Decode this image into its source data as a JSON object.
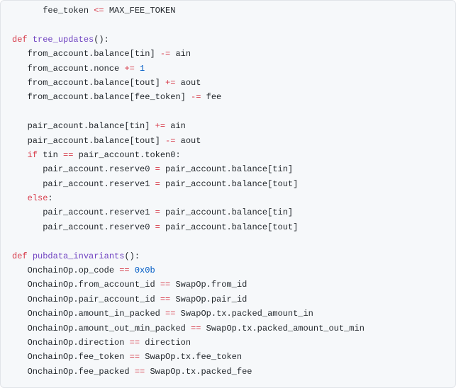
{
  "code": {
    "lines": [
      {
        "indent": 2,
        "tokens": [
          {
            "cls": "txt",
            "t": "fee_token "
          },
          {
            "cls": "op",
            "t": "<="
          },
          {
            "cls": "txt",
            "t": " MAX_FEE_TOKEN"
          }
        ]
      },
      {
        "indent": 0,
        "tokens": [
          {
            "cls": "txt",
            "t": ""
          }
        ]
      },
      {
        "indent": 0,
        "tokens": [
          {
            "cls": "kw",
            "t": "def"
          },
          {
            "cls": "txt",
            "t": " "
          },
          {
            "cls": "fn",
            "t": "tree_updates"
          },
          {
            "cls": "txt",
            "t": "():"
          }
        ]
      },
      {
        "indent": 1,
        "tokens": [
          {
            "cls": "txt",
            "t": "from_account.balance[tin] "
          },
          {
            "cls": "op",
            "t": "-="
          },
          {
            "cls": "txt",
            "t": " ain"
          }
        ]
      },
      {
        "indent": 1,
        "tokens": [
          {
            "cls": "txt",
            "t": "from_account.nonce "
          },
          {
            "cls": "op",
            "t": "+="
          },
          {
            "cls": "txt",
            "t": " "
          },
          {
            "cls": "num",
            "t": "1"
          }
        ]
      },
      {
        "indent": 1,
        "tokens": [
          {
            "cls": "txt",
            "t": "from_account.balance[tout] "
          },
          {
            "cls": "op",
            "t": "+="
          },
          {
            "cls": "txt",
            "t": " aout"
          }
        ]
      },
      {
        "indent": 1,
        "tokens": [
          {
            "cls": "txt",
            "t": "from_account.balance[fee_token] "
          },
          {
            "cls": "op",
            "t": "-="
          },
          {
            "cls": "txt",
            "t": " fee"
          }
        ]
      },
      {
        "indent": 0,
        "tokens": [
          {
            "cls": "txt",
            "t": ""
          }
        ]
      },
      {
        "indent": 1,
        "tokens": [
          {
            "cls": "txt",
            "t": "pair_acount.balance[tin] "
          },
          {
            "cls": "op",
            "t": "+="
          },
          {
            "cls": "txt",
            "t": " ain"
          }
        ]
      },
      {
        "indent": 1,
        "tokens": [
          {
            "cls": "txt",
            "t": "pair_account.balance[tout] "
          },
          {
            "cls": "op",
            "t": "-="
          },
          {
            "cls": "txt",
            "t": " aout"
          }
        ]
      },
      {
        "indent": 1,
        "tokens": [
          {
            "cls": "kw",
            "t": "if"
          },
          {
            "cls": "txt",
            "t": " tin "
          },
          {
            "cls": "op",
            "t": "=="
          },
          {
            "cls": "txt",
            "t": " pair_account.token0:"
          }
        ]
      },
      {
        "indent": 2,
        "tokens": [
          {
            "cls": "txt",
            "t": "pair_account.reserve0 "
          },
          {
            "cls": "op",
            "t": "="
          },
          {
            "cls": "txt",
            "t": " pair_account.balance[tin]"
          }
        ]
      },
      {
        "indent": 2,
        "tokens": [
          {
            "cls": "txt",
            "t": "pair_account.reserve1 "
          },
          {
            "cls": "op",
            "t": "="
          },
          {
            "cls": "txt",
            "t": " pair_account.balance[tout]"
          }
        ]
      },
      {
        "indent": 1,
        "tokens": [
          {
            "cls": "kw",
            "t": "else"
          },
          {
            "cls": "txt",
            "t": ":"
          }
        ]
      },
      {
        "indent": 2,
        "tokens": [
          {
            "cls": "txt",
            "t": "pair_account.reserve1 "
          },
          {
            "cls": "op",
            "t": "="
          },
          {
            "cls": "txt",
            "t": " pair_account.balance[tin]"
          }
        ]
      },
      {
        "indent": 2,
        "tokens": [
          {
            "cls": "txt",
            "t": "pair_account.reserve0 "
          },
          {
            "cls": "op",
            "t": "="
          },
          {
            "cls": "txt",
            "t": " pair_account.balance[tout]"
          }
        ]
      },
      {
        "indent": 0,
        "tokens": [
          {
            "cls": "txt",
            "t": ""
          }
        ]
      },
      {
        "indent": 0,
        "tokens": [
          {
            "cls": "kw",
            "t": "def"
          },
          {
            "cls": "txt",
            "t": " "
          },
          {
            "cls": "fn",
            "t": "pubdata_invariants"
          },
          {
            "cls": "txt",
            "t": "():"
          }
        ]
      },
      {
        "indent": 1,
        "tokens": [
          {
            "cls": "txt",
            "t": "OnchainOp.op_code "
          },
          {
            "cls": "op",
            "t": "=="
          },
          {
            "cls": "txt",
            "t": " "
          },
          {
            "cls": "num",
            "t": "0x0b"
          }
        ]
      },
      {
        "indent": 1,
        "tokens": [
          {
            "cls": "txt",
            "t": "OnchainOp.from_account_id "
          },
          {
            "cls": "op",
            "t": "=="
          },
          {
            "cls": "txt",
            "t": " SwapOp.from_id"
          }
        ]
      },
      {
        "indent": 1,
        "tokens": [
          {
            "cls": "txt",
            "t": "OnchainOp.pair_account_id "
          },
          {
            "cls": "op",
            "t": "=="
          },
          {
            "cls": "txt",
            "t": " SwapOp.pair_id"
          }
        ]
      },
      {
        "indent": 1,
        "tokens": [
          {
            "cls": "txt",
            "t": "OnchainOp.amount_in_packed "
          },
          {
            "cls": "op",
            "t": "=="
          },
          {
            "cls": "txt",
            "t": " SwapOp.tx.packed_amount_in"
          }
        ]
      },
      {
        "indent": 1,
        "tokens": [
          {
            "cls": "txt",
            "t": "OnchainOp.amount_out_min_packed "
          },
          {
            "cls": "op",
            "t": "=="
          },
          {
            "cls": "txt",
            "t": " SwapOp.tx.packed_amount_out_min"
          }
        ]
      },
      {
        "indent": 1,
        "tokens": [
          {
            "cls": "txt",
            "t": "OnchainOp.direction "
          },
          {
            "cls": "op",
            "t": "=="
          },
          {
            "cls": "txt",
            "t": " direction"
          }
        ]
      },
      {
        "indent": 1,
        "tokens": [
          {
            "cls": "txt",
            "t": "OnchainOp.fee_token "
          },
          {
            "cls": "op",
            "t": "=="
          },
          {
            "cls": "txt",
            "t": " SwapOp.tx.fee_token"
          }
        ]
      },
      {
        "indent": 1,
        "tokens": [
          {
            "cls": "txt",
            "t": "OnchainOp.fee_packed "
          },
          {
            "cls": "op",
            "t": "=="
          },
          {
            "cls": "txt",
            "t": " SwapOp.tx.packed_fee"
          }
        ]
      }
    ],
    "indent_unit": "   "
  }
}
